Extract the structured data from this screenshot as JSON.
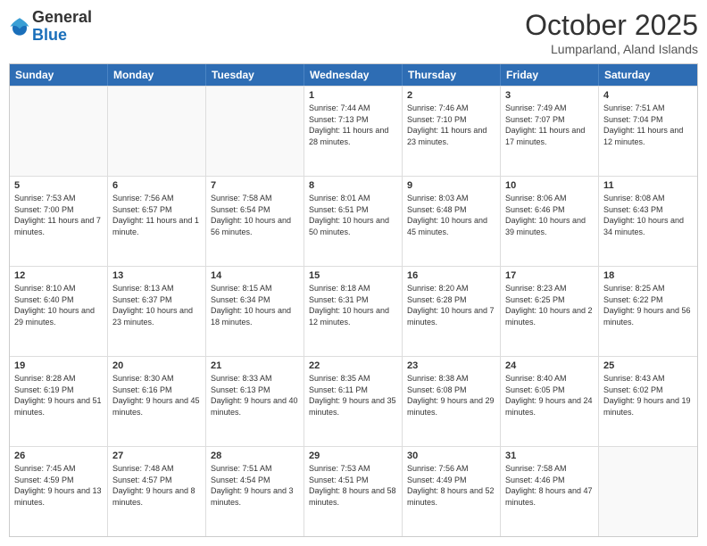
{
  "logo": {
    "general": "General",
    "blue": "Blue"
  },
  "title": "October 2025",
  "location": "Lumparland, Aland Islands",
  "days": [
    "Sunday",
    "Monday",
    "Tuesday",
    "Wednesday",
    "Thursday",
    "Friday",
    "Saturday"
  ],
  "weeks": [
    [
      {
        "day": "",
        "sunrise": "",
        "sunset": "",
        "daylight": ""
      },
      {
        "day": "",
        "sunrise": "",
        "sunset": "",
        "daylight": ""
      },
      {
        "day": "",
        "sunrise": "",
        "sunset": "",
        "daylight": ""
      },
      {
        "day": "1",
        "sunrise": "Sunrise: 7:44 AM",
        "sunset": "Sunset: 7:13 PM",
        "daylight": "Daylight: 11 hours and 28 minutes."
      },
      {
        "day": "2",
        "sunrise": "Sunrise: 7:46 AM",
        "sunset": "Sunset: 7:10 PM",
        "daylight": "Daylight: 11 hours and 23 minutes."
      },
      {
        "day": "3",
        "sunrise": "Sunrise: 7:49 AM",
        "sunset": "Sunset: 7:07 PM",
        "daylight": "Daylight: 11 hours and 17 minutes."
      },
      {
        "day": "4",
        "sunrise": "Sunrise: 7:51 AM",
        "sunset": "Sunset: 7:04 PM",
        "daylight": "Daylight: 11 hours and 12 minutes."
      }
    ],
    [
      {
        "day": "5",
        "sunrise": "Sunrise: 7:53 AM",
        "sunset": "Sunset: 7:00 PM",
        "daylight": "Daylight: 11 hours and 7 minutes."
      },
      {
        "day": "6",
        "sunrise": "Sunrise: 7:56 AM",
        "sunset": "Sunset: 6:57 PM",
        "daylight": "Daylight: 11 hours and 1 minute."
      },
      {
        "day": "7",
        "sunrise": "Sunrise: 7:58 AM",
        "sunset": "Sunset: 6:54 PM",
        "daylight": "Daylight: 10 hours and 56 minutes."
      },
      {
        "day": "8",
        "sunrise": "Sunrise: 8:01 AM",
        "sunset": "Sunset: 6:51 PM",
        "daylight": "Daylight: 10 hours and 50 minutes."
      },
      {
        "day": "9",
        "sunrise": "Sunrise: 8:03 AM",
        "sunset": "Sunset: 6:48 PM",
        "daylight": "Daylight: 10 hours and 45 minutes."
      },
      {
        "day": "10",
        "sunrise": "Sunrise: 8:06 AM",
        "sunset": "Sunset: 6:46 PM",
        "daylight": "Daylight: 10 hours and 39 minutes."
      },
      {
        "day": "11",
        "sunrise": "Sunrise: 8:08 AM",
        "sunset": "Sunset: 6:43 PM",
        "daylight": "Daylight: 10 hours and 34 minutes."
      }
    ],
    [
      {
        "day": "12",
        "sunrise": "Sunrise: 8:10 AM",
        "sunset": "Sunset: 6:40 PM",
        "daylight": "Daylight: 10 hours and 29 minutes."
      },
      {
        "day": "13",
        "sunrise": "Sunrise: 8:13 AM",
        "sunset": "Sunset: 6:37 PM",
        "daylight": "Daylight: 10 hours and 23 minutes."
      },
      {
        "day": "14",
        "sunrise": "Sunrise: 8:15 AM",
        "sunset": "Sunset: 6:34 PM",
        "daylight": "Daylight: 10 hours and 18 minutes."
      },
      {
        "day": "15",
        "sunrise": "Sunrise: 8:18 AM",
        "sunset": "Sunset: 6:31 PM",
        "daylight": "Daylight: 10 hours and 12 minutes."
      },
      {
        "day": "16",
        "sunrise": "Sunrise: 8:20 AM",
        "sunset": "Sunset: 6:28 PM",
        "daylight": "Daylight: 10 hours and 7 minutes."
      },
      {
        "day": "17",
        "sunrise": "Sunrise: 8:23 AM",
        "sunset": "Sunset: 6:25 PM",
        "daylight": "Daylight: 10 hours and 2 minutes."
      },
      {
        "day": "18",
        "sunrise": "Sunrise: 8:25 AM",
        "sunset": "Sunset: 6:22 PM",
        "daylight": "Daylight: 9 hours and 56 minutes."
      }
    ],
    [
      {
        "day": "19",
        "sunrise": "Sunrise: 8:28 AM",
        "sunset": "Sunset: 6:19 PM",
        "daylight": "Daylight: 9 hours and 51 minutes."
      },
      {
        "day": "20",
        "sunrise": "Sunrise: 8:30 AM",
        "sunset": "Sunset: 6:16 PM",
        "daylight": "Daylight: 9 hours and 45 minutes."
      },
      {
        "day": "21",
        "sunrise": "Sunrise: 8:33 AM",
        "sunset": "Sunset: 6:13 PM",
        "daylight": "Daylight: 9 hours and 40 minutes."
      },
      {
        "day": "22",
        "sunrise": "Sunrise: 8:35 AM",
        "sunset": "Sunset: 6:11 PM",
        "daylight": "Daylight: 9 hours and 35 minutes."
      },
      {
        "day": "23",
        "sunrise": "Sunrise: 8:38 AM",
        "sunset": "Sunset: 6:08 PM",
        "daylight": "Daylight: 9 hours and 29 minutes."
      },
      {
        "day": "24",
        "sunrise": "Sunrise: 8:40 AM",
        "sunset": "Sunset: 6:05 PM",
        "daylight": "Daylight: 9 hours and 24 minutes."
      },
      {
        "day": "25",
        "sunrise": "Sunrise: 8:43 AM",
        "sunset": "Sunset: 6:02 PM",
        "daylight": "Daylight: 9 hours and 19 minutes."
      }
    ],
    [
      {
        "day": "26",
        "sunrise": "Sunrise: 7:45 AM",
        "sunset": "Sunset: 4:59 PM",
        "daylight": "Daylight: 9 hours and 13 minutes."
      },
      {
        "day": "27",
        "sunrise": "Sunrise: 7:48 AM",
        "sunset": "Sunset: 4:57 PM",
        "daylight": "Daylight: 9 hours and 8 minutes."
      },
      {
        "day": "28",
        "sunrise": "Sunrise: 7:51 AM",
        "sunset": "Sunset: 4:54 PM",
        "daylight": "Daylight: 9 hours and 3 minutes."
      },
      {
        "day": "29",
        "sunrise": "Sunrise: 7:53 AM",
        "sunset": "Sunset: 4:51 PM",
        "daylight": "Daylight: 8 hours and 58 minutes."
      },
      {
        "day": "30",
        "sunrise": "Sunrise: 7:56 AM",
        "sunset": "Sunset: 4:49 PM",
        "daylight": "Daylight: 8 hours and 52 minutes."
      },
      {
        "day": "31",
        "sunrise": "Sunrise: 7:58 AM",
        "sunset": "Sunset: 4:46 PM",
        "daylight": "Daylight: 8 hours and 47 minutes."
      },
      {
        "day": "",
        "sunrise": "",
        "sunset": "",
        "daylight": ""
      }
    ]
  ]
}
